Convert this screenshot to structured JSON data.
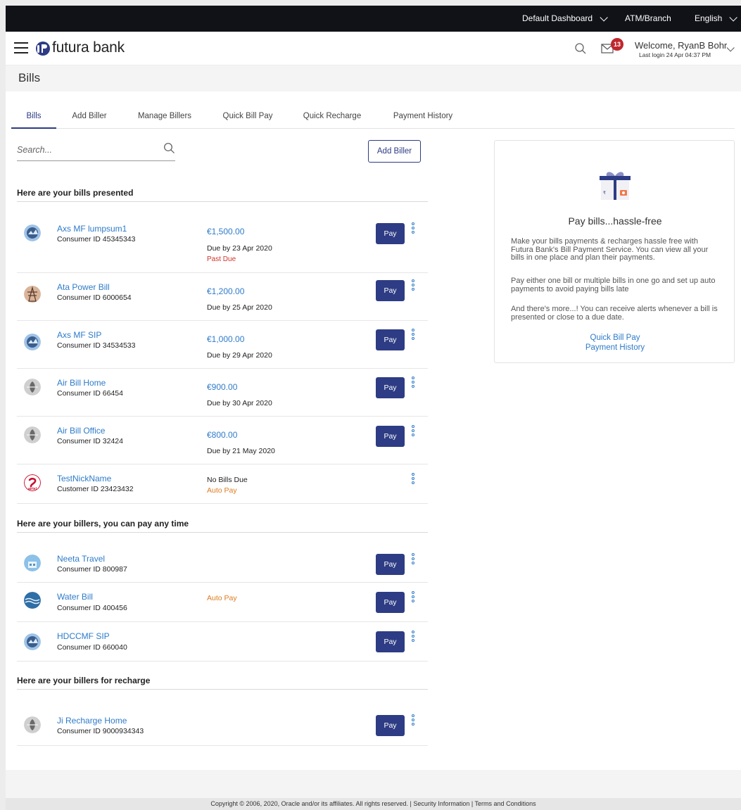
{
  "topbar": {
    "dashboard": "Default Dashboard",
    "atm": "ATM/Branch",
    "language": "English"
  },
  "header": {
    "logo_text": "futura bank",
    "notification_count": "13",
    "welcome": "Welcome, RyanB Bohr",
    "last_login": "Last login 24 Apr 04:37 PM"
  },
  "page": {
    "title": "Bills"
  },
  "tabs": [
    {
      "label": "Bills"
    },
    {
      "label": "Add Biller"
    },
    {
      "label": "Manage Billers"
    },
    {
      "label": "Quick Bill Pay"
    },
    {
      "label": "Quick Recharge"
    },
    {
      "label": "Payment History"
    }
  ],
  "search": {
    "placeholder": "Search..."
  },
  "add_biller_button": "Add Biller",
  "sections": {
    "presented": "Here are your bills presented",
    "anytime": "Here are your billers, you can pay any time",
    "recharge": "Here are your billers for recharge"
  },
  "presented_bills": [
    {
      "name": "Axs  MF lumpsum1",
      "id": "Consumer ID 45345343",
      "amount": "€1,500.00",
      "due": "Due by 23 Apr 2020",
      "past_due": "Past Due",
      "pay": "Pay"
    },
    {
      "name": "Ata Power Bill",
      "id": "Consumer ID 6000654",
      "amount": "€1,200.00",
      "due": "Due by 25 Apr 2020",
      "pay": "Pay"
    },
    {
      "name": "Axs  MF SIP",
      "id": "Consumer ID 34534533",
      "amount": "€1,000.00",
      "due": "Due by 29 Apr 2020",
      "pay": "Pay"
    },
    {
      "name": "Air Bill Home",
      "id": "Consumer ID 66454",
      "amount": "€900.00",
      "due": "Due by 30 Apr 2020",
      "pay": "Pay"
    },
    {
      "name": "Air Bill Office",
      "id": "Consumer ID 32424",
      "amount": "€800.00",
      "due": "Due by 21 May 2020",
      "pay": "Pay"
    },
    {
      "name": "TestNickName",
      "id": "Customer ID 23423432",
      "status": "No Bills Due",
      "auto_pay": "Auto Pay"
    }
  ],
  "anytime_billers": [
    {
      "name": "Neeta Travel",
      "id": "Consumer ID 800987",
      "pay": "Pay"
    },
    {
      "name": "Water Bill",
      "id": "Consumer ID 400456",
      "auto_pay": "Auto Pay",
      "pay": "Pay"
    },
    {
      "name": "HDCCMF SIP",
      "id": "Consumer ID 660040",
      "pay": "Pay"
    }
  ],
  "recharge_billers": [
    {
      "name": "Ji  Recharge Home",
      "id": "Consumer ID 9000934343",
      "pay": "Pay"
    }
  ],
  "promo": {
    "title": "Pay bills...hassle-free",
    "p1": "Make your bills payments & recharges hassle free with Futura Bank's Bill Payment Service. You can view all your bills in one place and plan their payments.",
    "p2": "Pay either one bill or multiple bills in one go and set up auto payments to avoid paying bills late",
    "p3": "And there's more...! You can receive alerts whenever a bill is presented or close to a due date.",
    "link1": "Quick Bill Pay",
    "link2": "Payment History"
  },
  "footer": {
    "copyright": "Copyright © 2006, 2020, Oracle and/or its affiliates. All rights reserved. | Security Information | Terms and Conditions"
  },
  "colors": {
    "primary": "#2d3c84",
    "link": "#2e7bc9",
    "past_due": "#d2342b",
    "auto_pay": "#e07b1f",
    "badge": "#c0262d"
  }
}
